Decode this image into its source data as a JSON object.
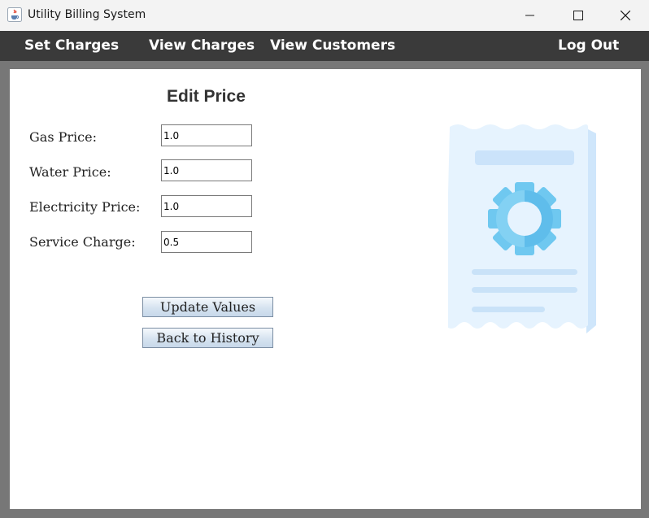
{
  "window": {
    "title": "Utility Billing System",
    "app_icon": "java-cup-icon",
    "controls": [
      "minimize-icon",
      "maximize-icon",
      "close-icon"
    ]
  },
  "menu": {
    "items": [
      "Set Charges",
      "View Charges",
      "View Customers"
    ],
    "logout": "Log Out"
  },
  "form": {
    "heading": "Edit Price",
    "fields": [
      {
        "label": "Gas Price:",
        "value": "1.0"
      },
      {
        "label": "Water Price:",
        "value": "1.0"
      },
      {
        "label": "Electricity Price:",
        "value": "1.0"
      },
      {
        "label": "Service Charge:",
        "value": "0.5"
      }
    ],
    "update_button": "Update Values",
    "back_button": "Back to History"
  },
  "illustration": {
    "icon": "receipt-gear-icon",
    "colors": {
      "paper": "#e3f1fd",
      "gear": "#6fc8f0",
      "lines": "#c9e2f8"
    }
  },
  "colors": {
    "menubar": "#3a3a3a",
    "frame": "#777777",
    "titlebar": "#f3f3f3"
  }
}
